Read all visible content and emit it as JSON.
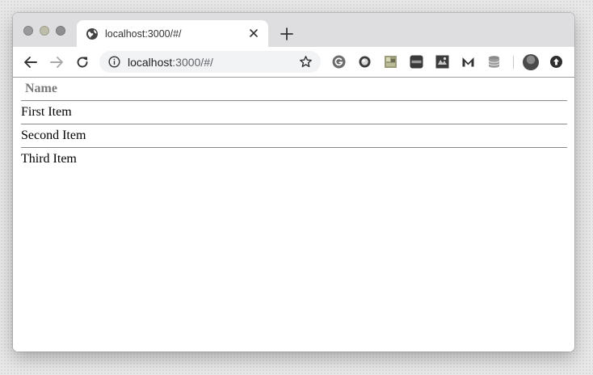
{
  "browser": {
    "tab": {
      "title": "localhost:3000/#/"
    },
    "omnibox": {
      "host": "localhost",
      "rest": ":3000/#/"
    },
    "extensions": [
      "google-g-icon",
      "circle-extension-icon",
      "image-extension-icon",
      "cors-extension-icon",
      "puzzle-map-extension-icon",
      "m-extension-icon",
      "database-extension-icon"
    ],
    "colors": {
      "tabstrip": "#dedee0",
      "omnibox": "#f1f3f4",
      "page": "#ffffff"
    }
  },
  "page": {
    "table": {
      "header": "Name",
      "rows": [
        "First Item",
        "Second Item",
        "Third Item"
      ]
    }
  }
}
